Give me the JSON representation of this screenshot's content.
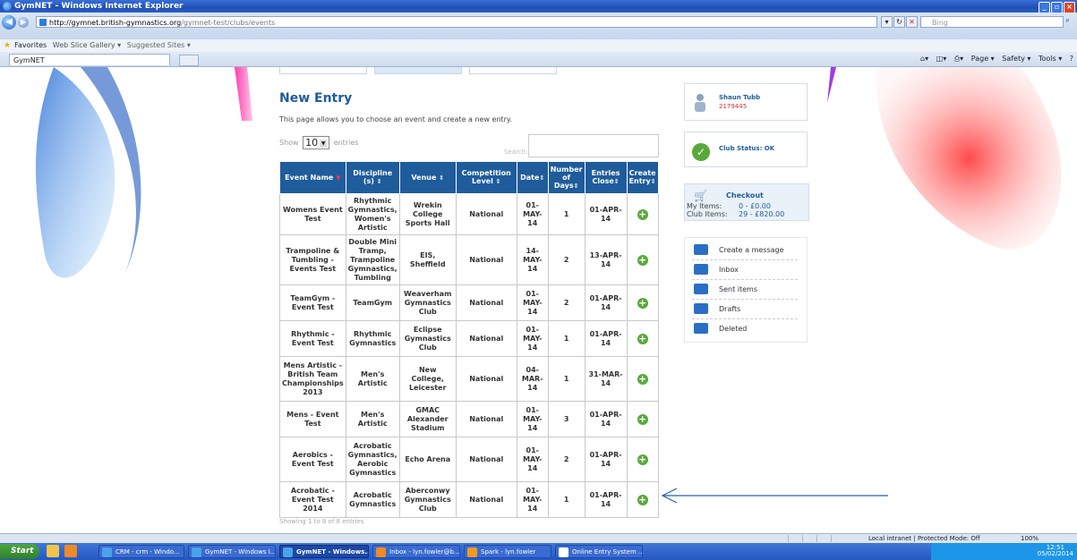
{
  "window": {
    "title": "GymNET - Windows Internet Explorer"
  },
  "address": {
    "url_host": "http://gymnet.british-gymnastics.org",
    "url_path": "/gymnet-test/clubs/events",
    "search_placeholder": "Bing"
  },
  "favorites": {
    "label": "Favorites",
    "web_slice": "Web Slice Gallery ▾",
    "suggested": "Suggested Sites ▾"
  },
  "tab": {
    "label": "GymNET"
  },
  "command_bar": {
    "page": "Page ▾",
    "safety": "Safety ▾",
    "tools": "Tools ▾"
  },
  "page": {
    "title": "New Entry",
    "description": "This page allows you to choose an event and create a new entry.",
    "show_label": "Show",
    "page_size": "10",
    "entries_label": "entries",
    "search_label": "Search:",
    "showing": "Showing 1 to 8 of 8 entries"
  },
  "table": {
    "headers": [
      "Event Name",
      "Discipline (s)",
      "Venue",
      "Competition Level",
      "Date",
      "Number of Days",
      "Entries Close",
      "Create Entry"
    ],
    "rows": [
      [
        "Womens Event Test",
        "Rhythmic Gymnastics, Women's Artistic",
        "Wrekin College Sports Hall",
        "National",
        "01-MAY-14",
        "1",
        "01-APR-14"
      ],
      [
        "Trampoline & Tumbling - Events Test",
        "Double Mini Tramp, Trampoline Gymnastics, Tumbling",
        "EIS, Sheffield",
        "National",
        "14-MAY-14",
        "2",
        "13-APR-14"
      ],
      [
        "TeamGym - Event Test",
        "TeamGym",
        "Weaverham Gymnastics Club",
        "National",
        "01-MAY-14",
        "2",
        "01-APR-14"
      ],
      [
        "Rhythmic - Event Test",
        "Rhythmic Gymnastics",
        "Eclipse Gymnastics Club",
        "National",
        "01-MAY-14",
        "1",
        "01-APR-14"
      ],
      [
        "Mens Artistic - British Team Championships 2013",
        "Men's Artistic",
        "New College, Leicester",
        "National",
        "04-MAR-14",
        "1",
        "31-MAR-14"
      ],
      [
        "Mens - Event Test",
        "Men's Artistic",
        "GMAC Alexander Stadium",
        "National",
        "01-MAY-14",
        "3",
        "01-APR-14"
      ],
      [
        "Aerobics - Event Test",
        "Acrobatic Gymnastics, Aerobic Gymnastics",
        "Echo Arena",
        "National",
        "01-MAY-14",
        "2",
        "01-APR-14"
      ],
      [
        "Acrobatic - Event Test 2014",
        "Acrobatic Gymnastics",
        "Aberconwy Gymnastics Club",
        "National",
        "01-MAY-14",
        "1",
        "01-APR-14"
      ]
    ]
  },
  "user": {
    "name": "Shaun Tubb",
    "id": "2179445"
  },
  "club_status": "Club Status: OK",
  "checkout": {
    "title": "Checkout",
    "my_items_label": "My Items:",
    "my_items_value": "0  -  £0.00",
    "club_items_label": "Club Items:",
    "club_items_value": "29  -  £820.00"
  },
  "messages": [
    "Create a message",
    "Inbox",
    "Sent items",
    "Drafts",
    "Deleted"
  ],
  "statusbar": {
    "zone": "Local intranet | Protected Mode: Off",
    "zoom": "100%"
  },
  "taskbar": {
    "start": "Start",
    "items": [
      "CRM - crm - Windo...",
      "GymNET - Windows I...",
      "GymNET - Windows...",
      "Inbox - lyn.fowler@b...",
      "Spark - lyn.fowler",
      "Online Entry System ..."
    ],
    "clock_time": "12:51",
    "clock_date": "05/02/2014"
  },
  "colors": {
    "brand_blue": "#1f5c9c",
    "add_green": "#5aa83c",
    "accent_red": "#c33"
  }
}
